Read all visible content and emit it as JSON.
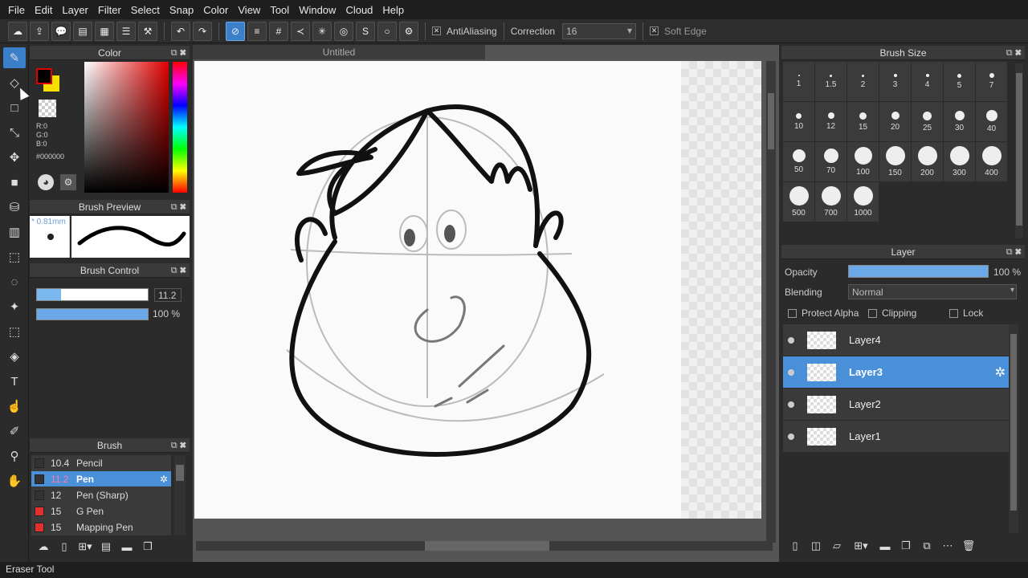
{
  "menu": [
    "File",
    "Edit",
    "Layer",
    "Filter",
    "Select",
    "Snap",
    "Color",
    "View",
    "Tool",
    "Window",
    "Cloud",
    "Help"
  ],
  "toolbar": {
    "antialias_label": "AntiAliasing",
    "correction_label": "Correction",
    "correction_value": "16",
    "soft_edge_label": "Soft Edge"
  },
  "color_panel": {
    "title": "Color",
    "r": "R:0",
    "g": "G:0",
    "b": "B:0",
    "hex": "#000000",
    "primary": "#e00000",
    "secondary": "#f5e000"
  },
  "brush_preview": {
    "title": "Brush Preview",
    "size": "* 0.81mm"
  },
  "brush_control": {
    "title": "Brush Control",
    "size_value": "11.2",
    "opacity_value": "100 %"
  },
  "brush_panel": {
    "title": "Brush",
    "items": [
      {
        "size": "10.4",
        "name": "Pencil",
        "color": "#333333"
      },
      {
        "size": "11.2",
        "name": "Pen",
        "color": "#333333"
      },
      {
        "size": "12",
        "name": "Pen (Sharp)",
        "color": "#333333"
      },
      {
        "size": "15",
        "name": "G Pen",
        "color": "#e03030"
      },
      {
        "size": "15",
        "name": "Mapping Pen",
        "color": "#e03030"
      }
    ]
  },
  "document": {
    "tab": "Untitled"
  },
  "brush_size": {
    "title": "Brush Size",
    "sizes": [
      "1",
      "1.5",
      "2",
      "3",
      "4",
      "5",
      "7",
      "10",
      "12",
      "15",
      "20",
      "25",
      "30",
      "40",
      "50",
      "70",
      "100",
      "150",
      "200",
      "300",
      "400",
      "500",
      "700",
      "1000"
    ]
  },
  "layer_panel": {
    "title": "Layer",
    "opacity_label": "Opacity",
    "opacity_value": "100 %",
    "blending_label": "Blending",
    "blending_value": "Normal",
    "protect_alpha": "Protect Alpha",
    "clipping": "Clipping",
    "lock": "Lock",
    "layers": [
      "Layer4",
      "Layer3",
      "Layer2",
      "Layer1"
    ]
  },
  "status": "Eraser Tool"
}
